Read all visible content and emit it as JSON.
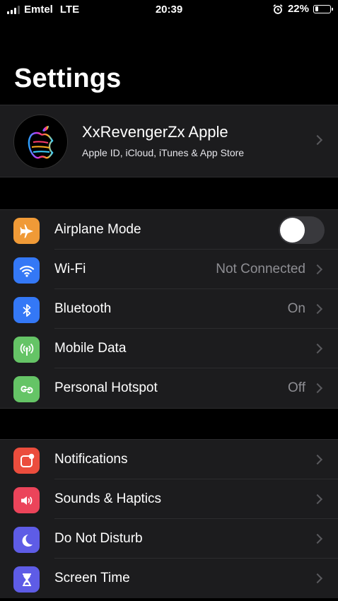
{
  "status_bar": {
    "carrier": "Emtel",
    "network": "LTE",
    "time": "20:39",
    "battery": "22%",
    "battery_level": 0.22
  },
  "page_title": "Settings",
  "profile": {
    "name": "XxRevengerZx Apple",
    "subtitle": "Apple ID, iCloud, iTunes & App Store"
  },
  "groups": [
    {
      "rows": [
        {
          "label": "Airplane Mode",
          "value": "",
          "icon": "airplane-icon",
          "color": "#f09a37",
          "toggle": true,
          "toggle_on": false
        },
        {
          "label": "Wi-Fi",
          "value": "Not Connected",
          "icon": "wifi-icon",
          "color": "#3478f6"
        },
        {
          "label": "Bluetooth",
          "value": "On",
          "icon": "bluetooth-icon",
          "color": "#3478f6"
        },
        {
          "label": "Mobile Data",
          "value": "",
          "icon": "antenna-icon",
          "color": "#65c466"
        },
        {
          "label": "Personal Hotspot",
          "value": "Off",
          "icon": "hotspot-icon",
          "color": "#65c466"
        }
      ]
    },
    {
      "rows": [
        {
          "label": "Notifications",
          "value": "",
          "icon": "notifications-icon",
          "color": "#eb4d3d"
        },
        {
          "label": "Sounds & Haptics",
          "value": "",
          "icon": "speaker-icon",
          "color": "#eb445a"
        },
        {
          "label": "Do Not Disturb",
          "value": "",
          "icon": "moon-icon",
          "color": "#5e5ce6"
        },
        {
          "label": "Screen Time",
          "value": "",
          "icon": "hourglass-icon",
          "color": "#5e5ce6"
        }
      ]
    }
  ]
}
